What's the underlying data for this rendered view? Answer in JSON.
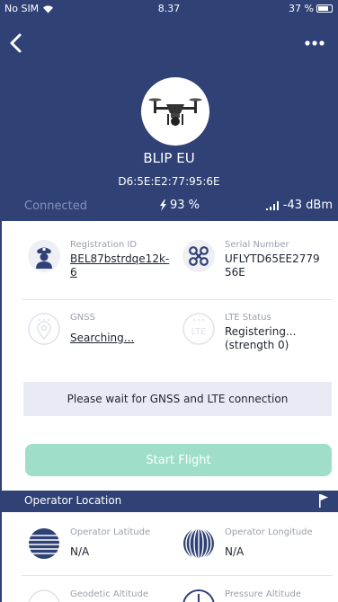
{
  "status_bar": {
    "carrier": "No SIM",
    "time": "8.37",
    "battery_pct": "37 %"
  },
  "device": {
    "name": "BLIP EU",
    "mac": "D6:5E:E2:77:95:6E"
  },
  "stats": {
    "connection": "Connected",
    "battery": "93 %",
    "signal": "-43 dBm"
  },
  "info": {
    "registration": {
      "label": "Registration ID",
      "value_line1": "BEL87bstrdqe12k-",
      "value_line2": "6"
    },
    "serial": {
      "label": "Serial Number",
      "value_line1": "UFLYTD65EE2779",
      "value_line2": "56E"
    },
    "gnss": {
      "label": "GNSS",
      "value": "Searching..."
    },
    "lte": {
      "label": "LTE Status",
      "value_line1": "Registering...",
      "value_line2": "(strength 0)"
    }
  },
  "wait_message": "Please wait for GNSS and LTE connection",
  "start_button": "Start Flight",
  "operator_section": {
    "title": "Operator Location"
  },
  "operator": {
    "latitude": {
      "label": "Operator Latitude",
      "value": "N/A"
    },
    "longitude": {
      "label": "Operator Longitude",
      "value": "N/A"
    },
    "geodetic": {
      "label": "Geodetic Altitude"
    },
    "pressure": {
      "label": "Pressure Altitude"
    }
  },
  "icons": {
    "back": "back-arrow-icon",
    "more": "more-icon",
    "drone": "drone-icon",
    "battery": "lightning-icon",
    "signal": "signal-bars-icon",
    "pilot": "pilot-icon",
    "serial": "drone-serial-icon",
    "gnss": "gnss-icon",
    "lte": "lte-icon",
    "latitude": "latitude-icon",
    "longitude": "longitude-icon",
    "flag": "flag-icon"
  },
  "colors": {
    "header": "#2f4175",
    "accent_button": "#9fdfc9",
    "banner": "#eaeaf6"
  }
}
